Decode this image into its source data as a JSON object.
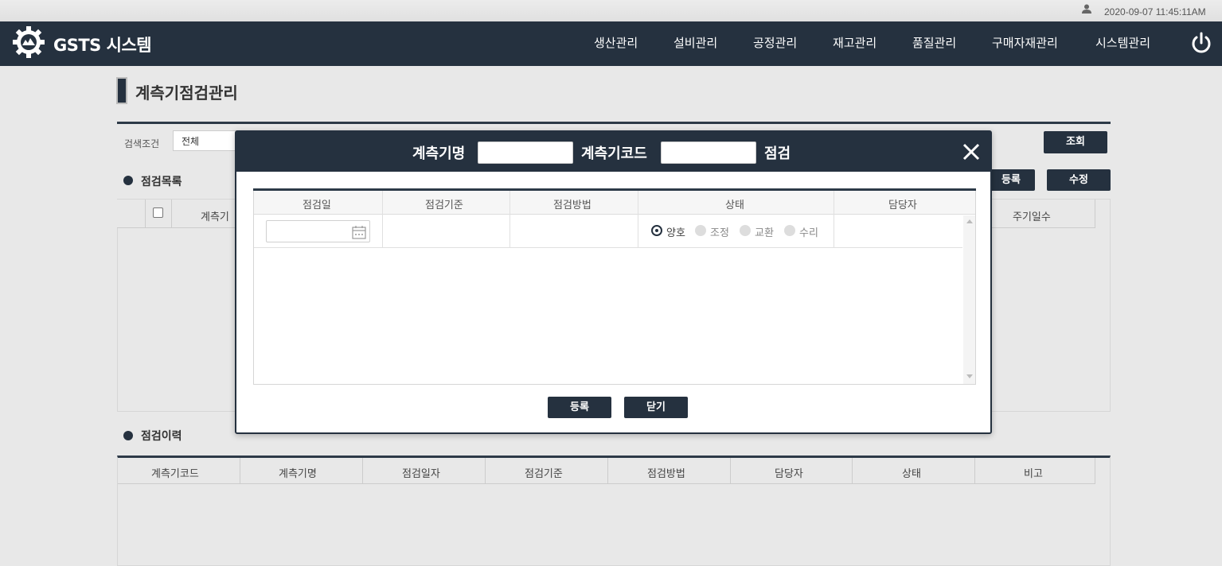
{
  "topbar": {
    "datetime": "2020-09-07 11:45:11AM"
  },
  "brand": {
    "name": "GSTS 시스템"
  },
  "nav": {
    "items": [
      "생산관리",
      "설비관리",
      "공정관리",
      "재고관리",
      "품질관리",
      "구매자재관리",
      "시스템관리"
    ]
  },
  "page": {
    "title": "계측기점검관리"
  },
  "search": {
    "label": "검색조건",
    "select_value": "전체",
    "query_button": "조회"
  },
  "list": {
    "title": "점검목록",
    "register_button": "등록",
    "edit_button": "수정",
    "columns": [
      "계측기",
      "주기일수"
    ]
  },
  "history": {
    "title": "점검이력",
    "columns": [
      "계측기코드",
      "계측기명",
      "점검일자",
      "점검기준",
      "점검방법",
      "담당자",
      "상태",
      "비고"
    ]
  },
  "modal": {
    "name_label": "계측기명",
    "code_label": "계측기코드",
    "suffix_label": "점검",
    "columns": [
      "점검일",
      "점검기준",
      "점검방법",
      "상태",
      "담당자"
    ],
    "status_options": [
      "양호",
      "조정",
      "교환",
      "수리"
    ],
    "status_selected": "양호",
    "register_button": "등록",
    "close_button": "닫기"
  },
  "colors": {
    "primary": "#25313f",
    "background": "#e8e8e8"
  }
}
